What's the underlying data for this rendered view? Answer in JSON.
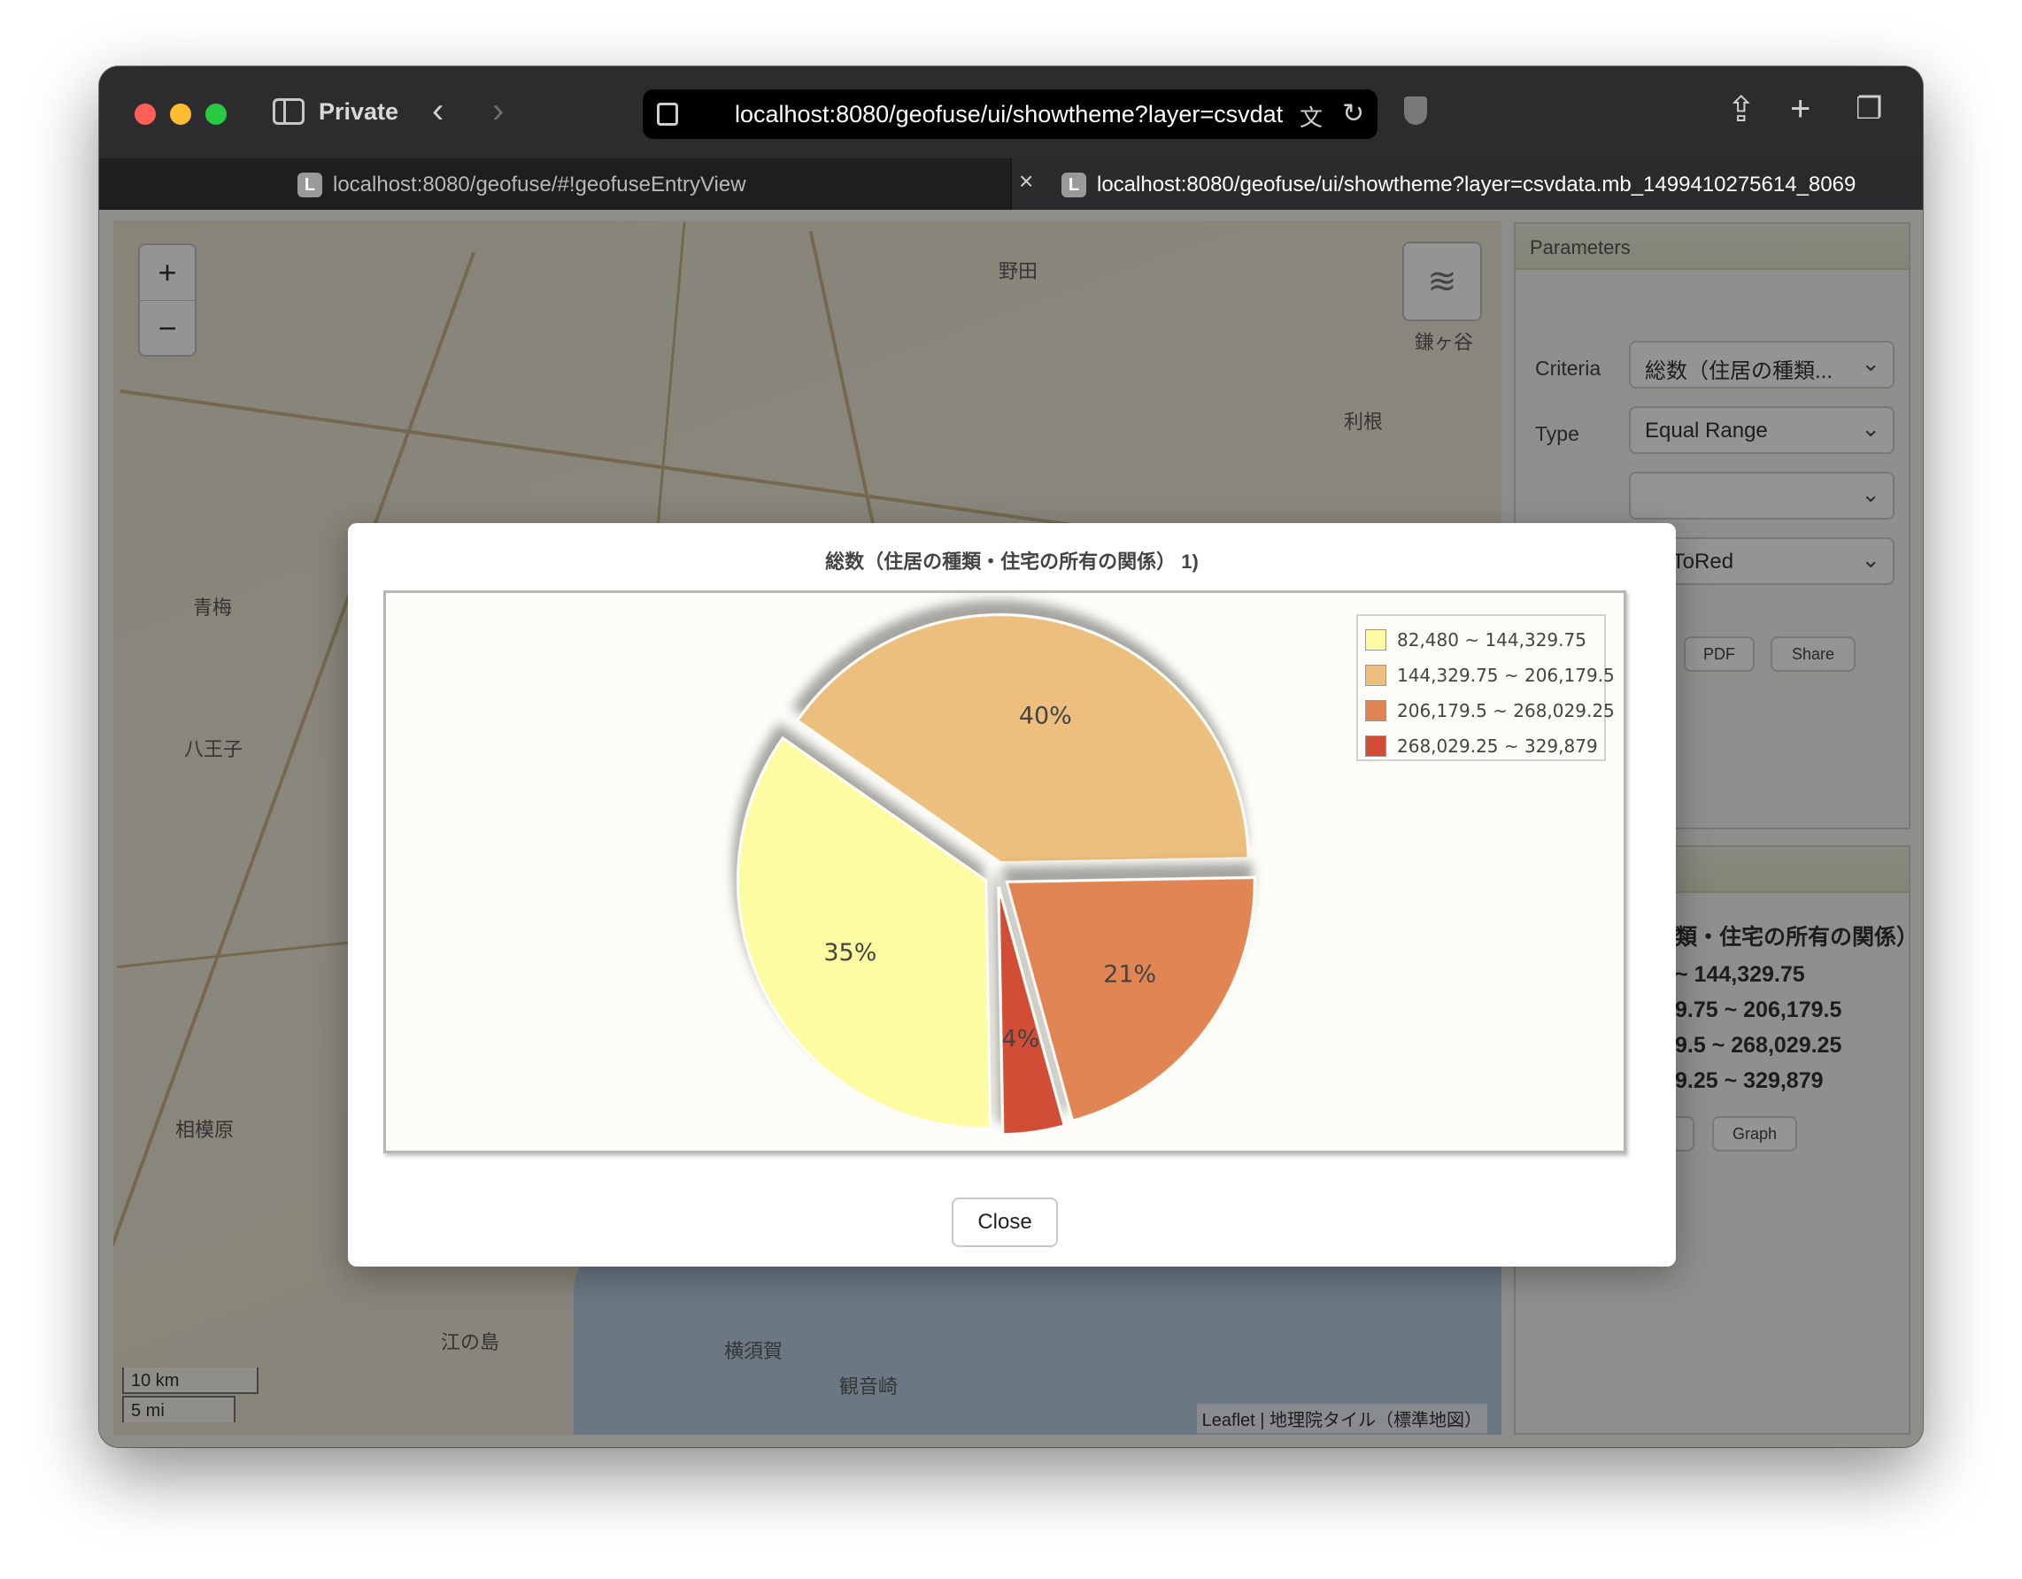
{
  "browser": {
    "private_label": "Private",
    "url": "localhost:8080/geofuse/ui/showtheme?layer=csvdata.mb_1499410275614_8069",
    "tabs": [
      {
        "label": "localhost:8080/geofuse/#!geofuseEntryView",
        "favicon": "L",
        "active": false
      },
      {
        "label": "localhost:8080/geofuse/ui/showtheme?layer=csvdata.mb_1499410275614_8069",
        "favicon": "L",
        "active": true
      }
    ]
  },
  "map": {
    "zoom_in": "+",
    "zoom_out": "−",
    "scale_km": "10 km",
    "scale_mi": "5 mi",
    "attribution": "Leaflet | 地理院タイル（標準地図）",
    "labels": [
      "青梅",
      "八王子",
      "相模原",
      "江の島",
      "横須賀",
      "野田",
      "鎌ヶ谷",
      "利根",
      "観音崎"
    ]
  },
  "panel": {
    "parameters_title": "Parameters",
    "criteria_label": "Criteria",
    "criteria_value": "総数（住居の種類...",
    "type_label": "Type",
    "type_value": "Equal Range",
    "classes_value": "",
    "color_value": "owToRed",
    "pdf_label": "PDF",
    "share_label": "Share",
    "legend_title": "類・住宅の所有の関係）",
    "legend_items": [
      "~ 144,329.75",
      "9.75 ~ 206,179.5",
      "9.5 ~ 268,029.25",
      "9.25 ~ 329,879"
    ],
    "graph_label": "Graph"
  },
  "modal": {
    "title": "総数（住居の種類・住宅の所有の関係） 1)",
    "close_label": "Close"
  },
  "chart_data": {
    "type": "pie",
    "title": "総数（住居の種類・住宅の所有の関係） 1)",
    "legend_position": "top-right",
    "slices": [
      {
        "label": "82,480 ~ 144,329.75",
        "value": 35,
        "display": "35%",
        "color": "#fdfca2"
      },
      {
        "label": "144,329.75 ~ 206,179.5",
        "value": 40,
        "display": "40%",
        "color": "#ecbf7e"
      },
      {
        "label": "206,179.5 ~ 268,029.25",
        "value": 21,
        "display": "21%",
        "color": "#e08552"
      },
      {
        "label": "268,029.25 ~ 329,879",
        "value": 4,
        "display": "4%",
        "color": "#d24d35"
      }
    ]
  }
}
